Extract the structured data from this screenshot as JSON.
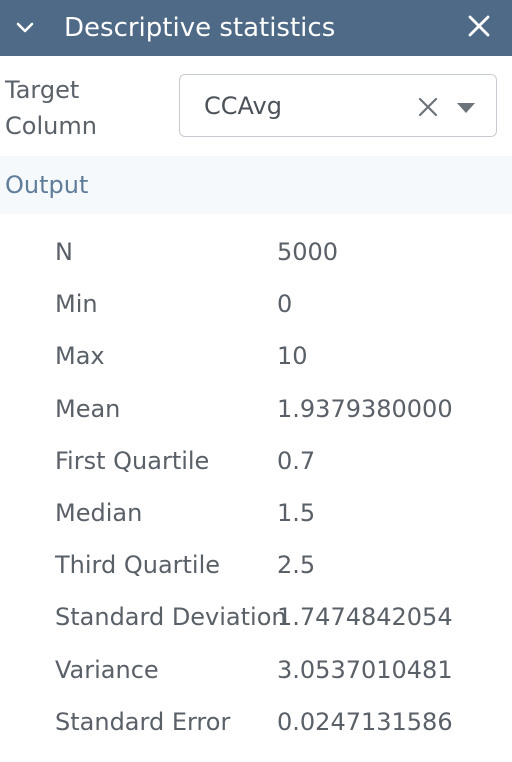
{
  "header": {
    "title": "Descriptive statistics",
    "collapse_icon": "chevron-down-icon",
    "close_icon": "close-icon",
    "background": "#4e6a87"
  },
  "target": {
    "label": "Target Column",
    "selected_value": "CCAvg",
    "clear_icon": "clear-icon",
    "dropdown_icon": "caret-down-icon"
  },
  "output": {
    "label": "Output",
    "stats": [
      {
        "label": "N",
        "value": "5000"
      },
      {
        "label": "Min",
        "value": "0"
      },
      {
        "label": "Max",
        "value": "10"
      },
      {
        "label": "Mean",
        "value": "1.9379380000"
      },
      {
        "label": "First Quartile",
        "value": "0.7"
      },
      {
        "label": "Median",
        "value": "1.5"
      },
      {
        "label": "Third Quartile",
        "value": "2.5"
      },
      {
        "label": "Standard Deviation",
        "value": "1.7474842054"
      },
      {
        "label": "Variance",
        "value": "3.0537010481"
      },
      {
        "label": "Standard Error",
        "value": "0.0247131586"
      }
    ]
  }
}
